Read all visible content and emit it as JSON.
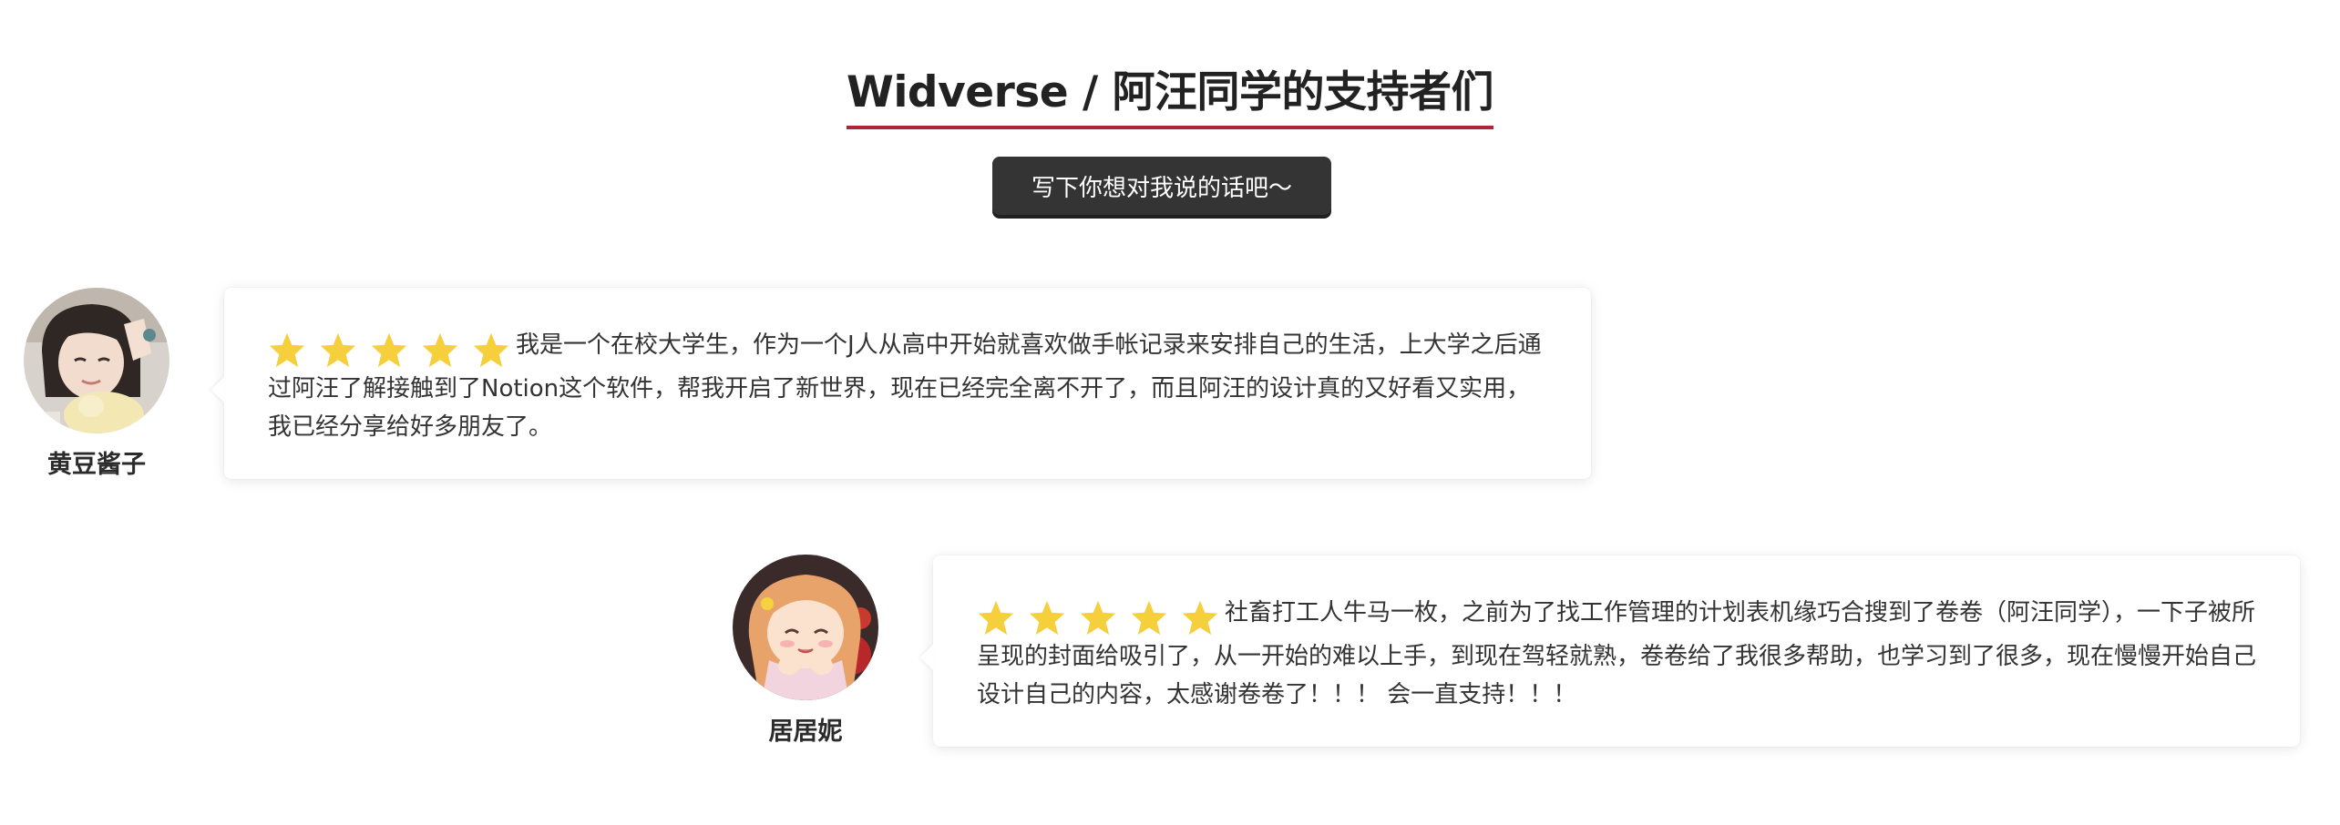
{
  "header": {
    "title": "Widverse / 阿汪同学的支持者们",
    "accent_color": "#b0243a"
  },
  "cta": {
    "label": "写下你想对我说的话吧～"
  },
  "reviews": [
    {
      "name": "黄豆酱子",
      "rating": 5,
      "text": "我是一个在校大学生，作为一个J人从高中开始就喜欢做手帐记录来安排自己的生活，上大学之后通过阿汪了解接触到了Notion这个软件，帮我开启了新世界，现在已经完全离不开了，而且阿汪的设计真的又好看又实用，我已经分享给好多朋友了。"
    },
    {
      "name": "居居妮",
      "rating": 5,
      "text": "社畜打工人牛马一枚，之前为了找工作管理的计划表机缘巧合搜到了卷卷（阿汪同学），一下子被所呈现的封面给吸引了，从一开始的难以上手，到现在驾轻就熟，卷卷给了我很多帮助，也学习到了很多，现在慢慢开始自己设计自己的内容，太感谢卷卷了！！！ 会一直支持！！！"
    }
  ],
  "icons": {
    "star": "star-icon",
    "star_color": "#f5cf3c"
  }
}
